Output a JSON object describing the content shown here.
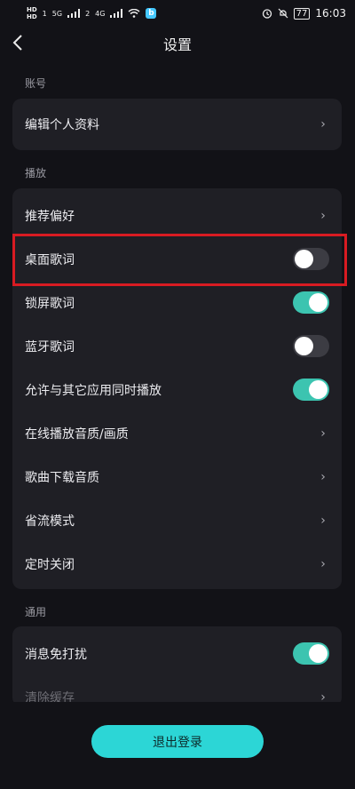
{
  "status_bar": {
    "hd_top": "HD",
    "hd_bottom": "HD",
    "sim1": "1",
    "sim2": "2",
    "net1": "5G",
    "net2": "4G",
    "battery": "77",
    "time": "16:03"
  },
  "header": {
    "title": "设置"
  },
  "sections": {
    "account": {
      "label": "账号",
      "items": [
        {
          "label": "编辑个人资料"
        }
      ]
    },
    "playback": {
      "label": "播放",
      "items": [
        {
          "label": "推荐偏好"
        },
        {
          "label": "桌面歌词",
          "toggle": "off"
        },
        {
          "label": "锁屏歌词",
          "toggle": "on"
        },
        {
          "label": "蓝牙歌词",
          "toggle": "off"
        },
        {
          "label": "允许与其它应用同时播放",
          "toggle": "on"
        },
        {
          "label": "在线播放音质/画质"
        },
        {
          "label": "歌曲下载音质"
        },
        {
          "label": "省流模式"
        },
        {
          "label": "定时关闭"
        }
      ]
    },
    "general": {
      "label": "通用",
      "items": [
        {
          "label": "消息免打扰",
          "toggle": "on"
        },
        {
          "label": "清除缓存"
        }
      ]
    }
  },
  "footer": {
    "logout_label": "退出登录"
  },
  "colors": {
    "background": "#121217",
    "card": "#1f1f25",
    "toggle_on": "#3cc4b0",
    "toggle_off": "#3c3c43",
    "logout_button": "#2cd6d6",
    "highlight_box": "#d81b22"
  }
}
